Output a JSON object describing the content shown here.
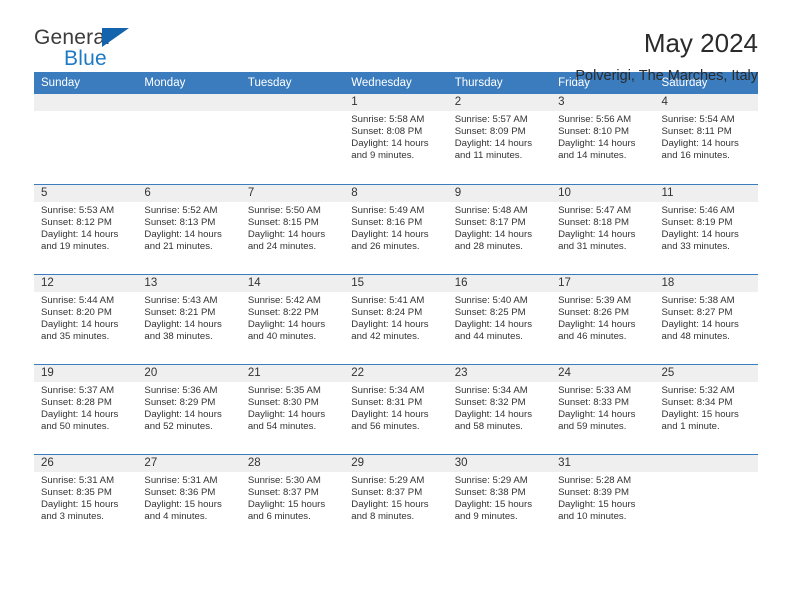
{
  "brand": {
    "name_part1": "General",
    "name_part2": "Blue",
    "color_dark": "#3c3c3c",
    "color_blue": "#1e7ac4",
    "triangle_color": "#1464ad"
  },
  "header": {
    "title": "May 2024",
    "subtitle": "Polverigi, The Marches, Italy"
  },
  "theme": {
    "header_band": "#3a7cbe",
    "daynum_band": "#efefef",
    "text": "#333333"
  },
  "weekdays": [
    "Sunday",
    "Monday",
    "Tuesday",
    "Wednesday",
    "Thursday",
    "Friday",
    "Saturday"
  ],
  "weeks": [
    [
      {
        "day": "",
        "empty": true
      },
      {
        "day": "",
        "empty": true
      },
      {
        "day": "",
        "empty": true
      },
      {
        "day": "1",
        "sunrise": "Sunrise: 5:58 AM",
        "sunset": "Sunset: 8:08 PM",
        "daylight_line1": "Daylight: 14 hours",
        "daylight_line2": "and 9 minutes."
      },
      {
        "day": "2",
        "sunrise": "Sunrise: 5:57 AM",
        "sunset": "Sunset: 8:09 PM",
        "daylight_line1": "Daylight: 14 hours",
        "daylight_line2": "and 11 minutes."
      },
      {
        "day": "3",
        "sunrise": "Sunrise: 5:56 AM",
        "sunset": "Sunset: 8:10 PM",
        "daylight_line1": "Daylight: 14 hours",
        "daylight_line2": "and 14 minutes."
      },
      {
        "day": "4",
        "sunrise": "Sunrise: 5:54 AM",
        "sunset": "Sunset: 8:11 PM",
        "daylight_line1": "Daylight: 14 hours",
        "daylight_line2": "and 16 minutes."
      }
    ],
    [
      {
        "day": "5",
        "sunrise": "Sunrise: 5:53 AM",
        "sunset": "Sunset: 8:12 PM",
        "daylight_line1": "Daylight: 14 hours",
        "daylight_line2": "and 19 minutes."
      },
      {
        "day": "6",
        "sunrise": "Sunrise: 5:52 AM",
        "sunset": "Sunset: 8:13 PM",
        "daylight_line1": "Daylight: 14 hours",
        "daylight_line2": "and 21 minutes."
      },
      {
        "day": "7",
        "sunrise": "Sunrise: 5:50 AM",
        "sunset": "Sunset: 8:15 PM",
        "daylight_line1": "Daylight: 14 hours",
        "daylight_line2": "and 24 minutes."
      },
      {
        "day": "8",
        "sunrise": "Sunrise: 5:49 AM",
        "sunset": "Sunset: 8:16 PM",
        "daylight_line1": "Daylight: 14 hours",
        "daylight_line2": "and 26 minutes."
      },
      {
        "day": "9",
        "sunrise": "Sunrise: 5:48 AM",
        "sunset": "Sunset: 8:17 PM",
        "daylight_line1": "Daylight: 14 hours",
        "daylight_line2": "and 28 minutes."
      },
      {
        "day": "10",
        "sunrise": "Sunrise: 5:47 AM",
        "sunset": "Sunset: 8:18 PM",
        "daylight_line1": "Daylight: 14 hours",
        "daylight_line2": "and 31 minutes."
      },
      {
        "day": "11",
        "sunrise": "Sunrise: 5:46 AM",
        "sunset": "Sunset: 8:19 PM",
        "daylight_line1": "Daylight: 14 hours",
        "daylight_line2": "and 33 minutes."
      }
    ],
    [
      {
        "day": "12",
        "sunrise": "Sunrise: 5:44 AM",
        "sunset": "Sunset: 8:20 PM",
        "daylight_line1": "Daylight: 14 hours",
        "daylight_line2": "and 35 minutes."
      },
      {
        "day": "13",
        "sunrise": "Sunrise: 5:43 AM",
        "sunset": "Sunset: 8:21 PM",
        "daylight_line1": "Daylight: 14 hours",
        "daylight_line2": "and 38 minutes."
      },
      {
        "day": "14",
        "sunrise": "Sunrise: 5:42 AM",
        "sunset": "Sunset: 8:22 PM",
        "daylight_line1": "Daylight: 14 hours",
        "daylight_line2": "and 40 minutes."
      },
      {
        "day": "15",
        "sunrise": "Sunrise: 5:41 AM",
        "sunset": "Sunset: 8:24 PM",
        "daylight_line1": "Daylight: 14 hours",
        "daylight_line2": "and 42 minutes."
      },
      {
        "day": "16",
        "sunrise": "Sunrise: 5:40 AM",
        "sunset": "Sunset: 8:25 PM",
        "daylight_line1": "Daylight: 14 hours",
        "daylight_line2": "and 44 minutes."
      },
      {
        "day": "17",
        "sunrise": "Sunrise: 5:39 AM",
        "sunset": "Sunset: 8:26 PM",
        "daylight_line1": "Daylight: 14 hours",
        "daylight_line2": "and 46 minutes."
      },
      {
        "day": "18",
        "sunrise": "Sunrise: 5:38 AM",
        "sunset": "Sunset: 8:27 PM",
        "daylight_line1": "Daylight: 14 hours",
        "daylight_line2": "and 48 minutes."
      }
    ],
    [
      {
        "day": "19",
        "sunrise": "Sunrise: 5:37 AM",
        "sunset": "Sunset: 8:28 PM",
        "daylight_line1": "Daylight: 14 hours",
        "daylight_line2": "and 50 minutes."
      },
      {
        "day": "20",
        "sunrise": "Sunrise: 5:36 AM",
        "sunset": "Sunset: 8:29 PM",
        "daylight_line1": "Daylight: 14 hours",
        "daylight_line2": "and 52 minutes."
      },
      {
        "day": "21",
        "sunrise": "Sunrise: 5:35 AM",
        "sunset": "Sunset: 8:30 PM",
        "daylight_line1": "Daylight: 14 hours",
        "daylight_line2": "and 54 minutes."
      },
      {
        "day": "22",
        "sunrise": "Sunrise: 5:34 AM",
        "sunset": "Sunset: 8:31 PM",
        "daylight_line1": "Daylight: 14 hours",
        "daylight_line2": "and 56 minutes."
      },
      {
        "day": "23",
        "sunrise": "Sunrise: 5:34 AM",
        "sunset": "Sunset: 8:32 PM",
        "daylight_line1": "Daylight: 14 hours",
        "daylight_line2": "and 58 minutes."
      },
      {
        "day": "24",
        "sunrise": "Sunrise: 5:33 AM",
        "sunset": "Sunset: 8:33 PM",
        "daylight_line1": "Daylight: 14 hours",
        "daylight_line2": "and 59 minutes."
      },
      {
        "day": "25",
        "sunrise": "Sunrise: 5:32 AM",
        "sunset": "Sunset: 8:34 PM",
        "daylight_line1": "Daylight: 15 hours",
        "daylight_line2": "and 1 minute."
      }
    ],
    [
      {
        "day": "26",
        "sunrise": "Sunrise: 5:31 AM",
        "sunset": "Sunset: 8:35 PM",
        "daylight_line1": "Daylight: 15 hours",
        "daylight_line2": "and 3 minutes."
      },
      {
        "day": "27",
        "sunrise": "Sunrise: 5:31 AM",
        "sunset": "Sunset: 8:36 PM",
        "daylight_line1": "Daylight: 15 hours",
        "daylight_line2": "and 4 minutes."
      },
      {
        "day": "28",
        "sunrise": "Sunrise: 5:30 AM",
        "sunset": "Sunset: 8:37 PM",
        "daylight_line1": "Daylight: 15 hours",
        "daylight_line2": "and 6 minutes."
      },
      {
        "day": "29",
        "sunrise": "Sunrise: 5:29 AM",
        "sunset": "Sunset: 8:37 PM",
        "daylight_line1": "Daylight: 15 hours",
        "daylight_line2": "and 8 minutes."
      },
      {
        "day": "30",
        "sunrise": "Sunrise: 5:29 AM",
        "sunset": "Sunset: 8:38 PM",
        "daylight_line1": "Daylight: 15 hours",
        "daylight_line2": "and 9 minutes."
      },
      {
        "day": "31",
        "sunrise": "Sunrise: 5:28 AM",
        "sunset": "Sunset: 8:39 PM",
        "daylight_line1": "Daylight: 15 hours",
        "daylight_line2": "and 10 minutes."
      },
      {
        "day": "",
        "empty": true
      }
    ]
  ]
}
